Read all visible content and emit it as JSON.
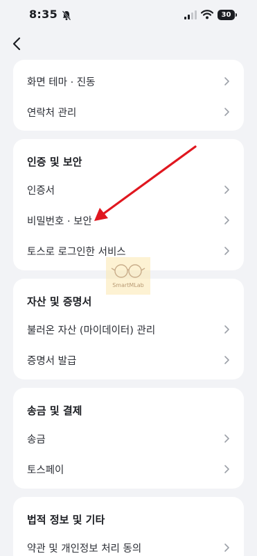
{
  "status": {
    "time": "8:35",
    "battery": "30"
  },
  "cards": [
    {
      "title": "",
      "items": [
        "화면 테마 · 진동",
        "연락처 관리"
      ]
    },
    {
      "title": "인증 및 보안",
      "items": [
        "인증서",
        "비밀번호 · 보안",
        "토스로 로그인한 서비스"
      ]
    },
    {
      "title": "자산 및 증명서",
      "items": [
        "불러온 자산 (마이데이터) 관리",
        "증명서 발급"
      ]
    },
    {
      "title": "송금 및 결제",
      "items": [
        "송금",
        "토스페이"
      ]
    },
    {
      "title": "법적 정보 및 기타",
      "items": [
        "약관 및 개인정보 처리 동의"
      ]
    }
  ],
  "watermark": "SmartMLab",
  "colors": {
    "arrow": "#e0171f",
    "background": "#f2f3f6",
    "card": "#ffffff"
  }
}
